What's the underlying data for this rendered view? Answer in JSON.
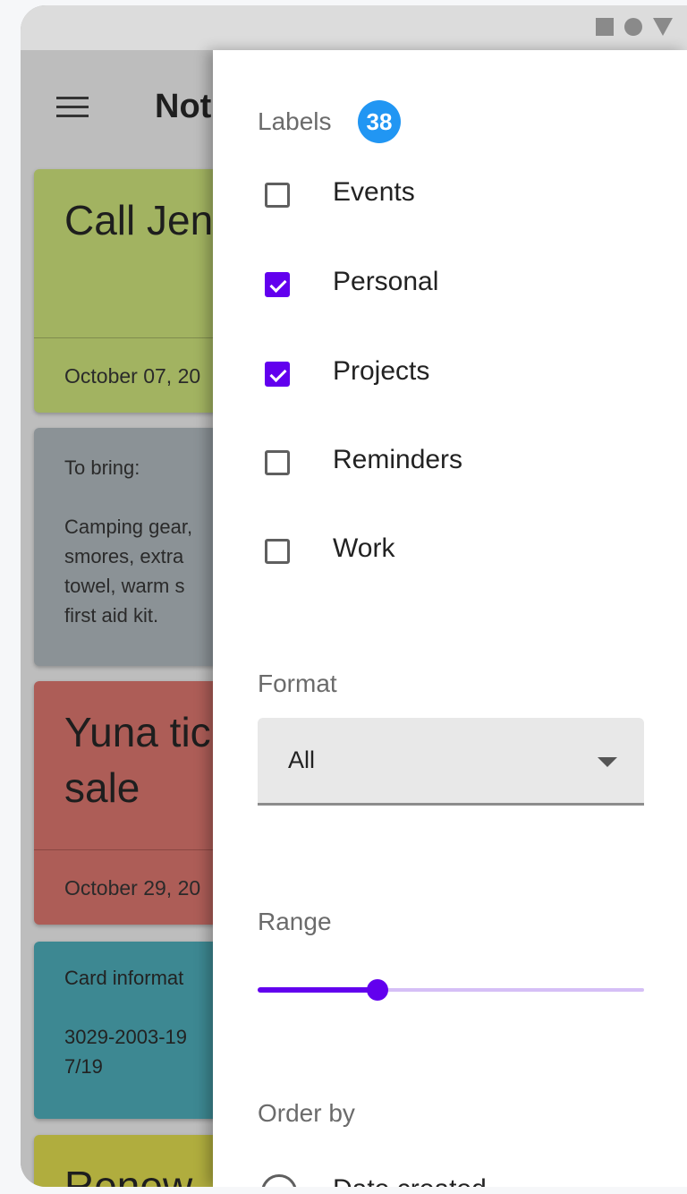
{
  "app": {
    "title": "Not",
    "cards": [
      {
        "title": "Call Jennife",
        "date": "October 07, 20",
        "color": "#a2b361"
      },
      {
        "text": "To bring:\n\nCamping gear,\nsmores, extra\ntowel, warm s\nfirst aid kit.",
        "color": "#8b9296"
      },
      {
        "title": "Yuna tic on sale",
        "date": "October 29, 20",
        "color": "#ad5d57"
      },
      {
        "text": "Card informat\n\n3029-2003-19\n7/19",
        "color": "#3d8892"
      },
      {
        "title": "Renew",
        "color": "#b0ad3e"
      }
    ]
  },
  "drawer": {
    "labels": {
      "title": "Labels",
      "count": "38",
      "items": [
        {
          "label": "Events",
          "checked": false
        },
        {
          "label": "Personal",
          "checked": true
        },
        {
          "label": "Projects",
          "checked": true
        },
        {
          "label": "Reminders",
          "checked": false
        },
        {
          "label": "Work",
          "checked": false
        }
      ]
    },
    "format": {
      "title": "Format",
      "selected": "All"
    },
    "range": {
      "title": "Range",
      "value_fraction": 0.31
    },
    "order_by": {
      "title": "Order by",
      "options": [
        {
          "label": "Date created",
          "selected": false
        }
      ]
    }
  },
  "colors": {
    "accent": "#6200ee",
    "badge": "#2196f3"
  }
}
